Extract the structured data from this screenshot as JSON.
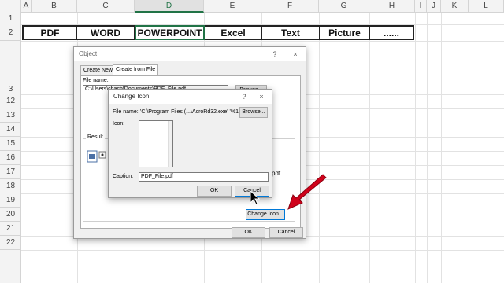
{
  "sheet": {
    "columns": [
      "A",
      "B",
      "C",
      "D",
      "E",
      "F",
      "G",
      "H",
      "I",
      "J",
      "K",
      "L"
    ],
    "selected_column": "D",
    "rows": [
      "1",
      "2",
      "3",
      "12",
      "13",
      "14",
      "15",
      "16",
      "17",
      "18",
      "19",
      "20",
      "21",
      "22"
    ],
    "row2_values": [
      "PDF",
      "WORD",
      "POWERPOINT",
      "Excel",
      "Text",
      "Picture",
      "......"
    ]
  },
  "object_dialog": {
    "title": "Object",
    "help": "?",
    "close": "×",
    "tabs": [
      "Create New",
      "Create from File"
    ],
    "file_name_label": "File name:",
    "file_name_value": "C:\\Users\\chach\\Documents\\PDF_File.pdf",
    "browse_label": "Browse...",
    "result_label": "Result",
    "file_suffix": "pdf",
    "change_icon_button": "Change Icon...",
    "ok": "OK",
    "cancel": "Cancel"
  },
  "change_icon_dialog": {
    "title": "Change Icon",
    "help": "?",
    "close": "×",
    "file_name_label": "File name:",
    "file_name_value": "'C:\\Program Files (...\\AcroRd32.exe' '%1'",
    "browse_label": "Browse...",
    "icon_label": "Icon:",
    "caption_label": "Caption:",
    "caption_value": "PDF_File.pdf",
    "ok": "OK",
    "cancel": "Cancel"
  },
  "colors": {
    "excel_green": "#217346",
    "arrow_red": "#d0021b",
    "focus_blue": "#0078d7"
  }
}
